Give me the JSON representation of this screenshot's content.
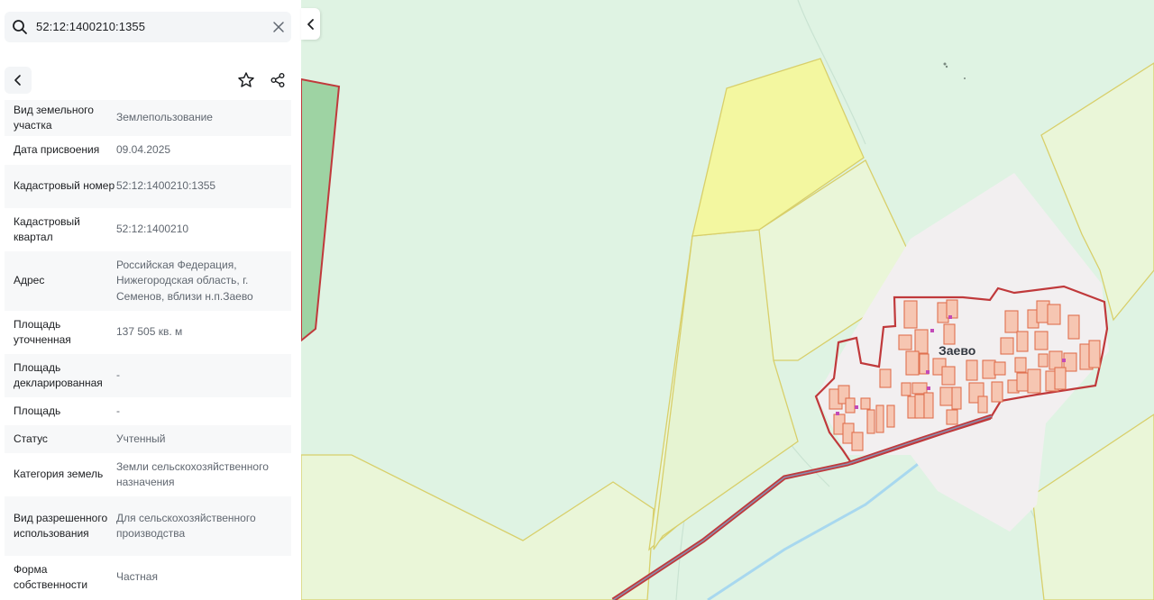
{
  "search": {
    "query": "52:12:1400210:1355",
    "search_icon": "search-icon",
    "clear_icon": "close-icon"
  },
  "toolbar": {
    "back_icon": "chevron-left-icon",
    "favorite_icon": "star-icon",
    "share_icon": "share-icon"
  },
  "properties": [
    {
      "label": "Вид земельного участка",
      "value": "Землепользование"
    },
    {
      "label": "Дата присвоения",
      "value": "09.04.2025"
    },
    {
      "label": "Кадастровый номер",
      "value": "52:12:1400210:1355"
    },
    {
      "label": "Кадастровый квартал",
      "value": "52:12:1400210"
    },
    {
      "label": "Адрес",
      "value": "Российская Федерация, Нижегородская область, г. Семенов, вблизи н.п.Заево"
    },
    {
      "label": "Площадь уточненная",
      "value": "137 505 кв. м"
    },
    {
      "label": "Площадь декларированная",
      "value": "-"
    },
    {
      "label": "Площадь",
      "value": "-"
    },
    {
      "label": "Статус",
      "value": "Учтенный"
    },
    {
      "label": "Категория земель",
      "value": "Земли сельскохозяйственного назначения"
    },
    {
      "label": "Вид разрешенного использования",
      "value": "Для сельскохозяйственного производства"
    },
    {
      "label": "Форма собственности",
      "value": "Частная"
    }
  ],
  "map": {
    "collapse_icon": "chevron-left-icon",
    "village_name": "Заево",
    "colors": {
      "background": "#dff3e3",
      "parcel_fill": "#eaf6d8",
      "parcel_border": "#d8cf6a",
      "highlight_fill": "#f3f7a0",
      "settlement_fill": "#f2eff0",
      "boundary_stroke": "#c0393b",
      "building_fill": "#f6c6b2",
      "building_stroke": "#e0714f",
      "forest_fill": "#9ed3a3",
      "water": "#a8d8ef"
    }
  }
}
